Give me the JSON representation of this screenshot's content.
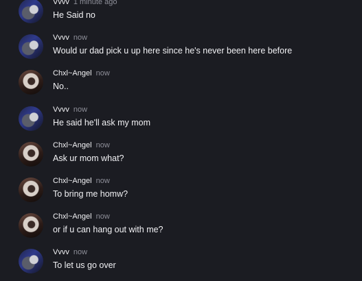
{
  "messages": [
    {
      "author": "Vvvv",
      "time": "1 minute ago",
      "text": "He Said no",
      "avatar": "vvvv-avatar"
    },
    {
      "author": "Vvvv",
      "time": "now",
      "text": "Would ur dad pick u up here since he's never been here before",
      "avatar": "vvvv-avatar"
    },
    {
      "author": "Chxl~Angel",
      "time": "now",
      "text": "No..",
      "avatar": "chxl-angel-avatar"
    },
    {
      "author": "Vvvv",
      "time": "now",
      "text": "He said he'll ask my mom",
      "avatar": "vvvv-avatar"
    },
    {
      "author": "Chxl~Angel",
      "time": "now",
      "text": "Ask ur mom what?",
      "avatar": "chxl-angel-avatar"
    },
    {
      "author": "Chxl~Angel",
      "time": "now",
      "text": "To bring me homw?",
      "avatar": "chxl-angel-avatar"
    },
    {
      "author": "Chxl~Angel",
      "time": "now",
      "text": "or if u can hang out with me?",
      "avatar": "chxl-angel-avatar"
    },
    {
      "author": "Vvvv",
      "time": "now",
      "text": "To let us go over",
      "avatar": "vvvv-avatar"
    }
  ]
}
